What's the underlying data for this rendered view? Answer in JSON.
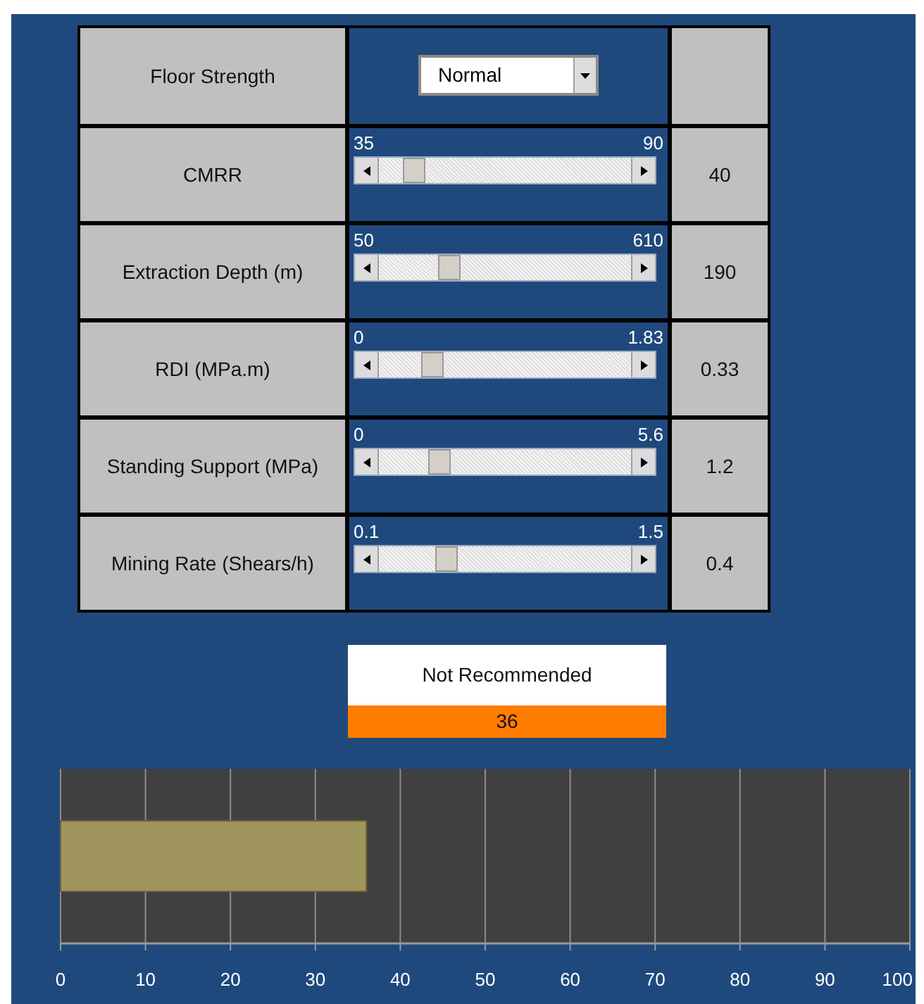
{
  "parameters": [
    {
      "kind": "select",
      "label": "Floor Strength",
      "value": "Normal"
    },
    {
      "kind": "slider",
      "label": "CMRR",
      "min": "35",
      "max": "90",
      "level": 0.1,
      "reading": "40"
    },
    {
      "kind": "slider",
      "label": "Extraction Depth (m)",
      "min": "50",
      "max": "610",
      "level": 0.25,
      "reading": "190"
    },
    {
      "kind": "slider",
      "label": "RDI (MPa.m)",
      "min": "0",
      "max": "1.83",
      "level": 0.18,
      "reading": "0.33"
    },
    {
      "kind": "slider",
      "label": "Standing Support (MPa)",
      "min": "0",
      "max": "5.6",
      "level": 0.21,
      "reading": "1.2"
    },
    {
      "kind": "slider",
      "label": "Mining Rate (Shears/h)",
      "min": "0.1",
      "max": "1.5",
      "level": 0.24,
      "reading": "0.4"
    }
  ],
  "result": {
    "status": "Not Recommended",
    "score": "36",
    "color": "#ff7c00"
  },
  "chart_data": {
    "type": "bar",
    "orientation": "horizontal",
    "grid": true,
    "series": [
      {
        "color": "#9f955c",
        "values": [
          36
        ]
      }
    ],
    "xlim": [
      0,
      100
    ],
    "xticks": [
      0,
      10,
      20,
      30,
      40,
      50,
      60,
      70,
      80,
      90,
      100
    ]
  }
}
